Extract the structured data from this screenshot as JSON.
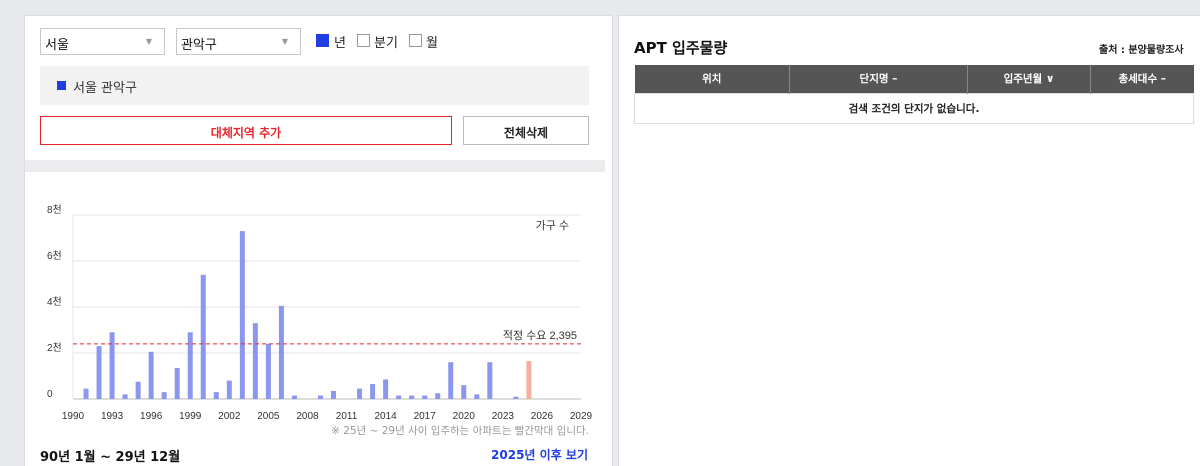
{
  "filters": {
    "city": "서울",
    "district": "관악구",
    "period_options": [
      {
        "label": "년",
        "checked": true
      },
      {
        "label": "분기",
        "checked": false
      },
      {
        "label": "월",
        "checked": false
      }
    ]
  },
  "region_tag": "서울 관악구",
  "buttons": {
    "add_region": "대체지역 추가",
    "delete_all": "전체삭제"
  },
  "chart_data": {
    "type": "bar",
    "legend": "가구 수",
    "x": [
      1990,
      1991,
      1992,
      1993,
      1994,
      1995,
      1996,
      1997,
      1998,
      1999,
      2000,
      2001,
      2002,
      2003,
      2004,
      2005,
      2006,
      2007,
      2008,
      2009,
      2010,
      2011,
      2012,
      2013,
      2014,
      2015,
      2016,
      2017,
      2018,
      2019,
      2020,
      2021,
      2022,
      2023,
      2024,
      2025,
      2026,
      2027,
      2028,
      2029
    ],
    "values": [
      0,
      450,
      2300,
      2900,
      200,
      750,
      2050,
      300,
      1350,
      2900,
      5400,
      300,
      800,
      7300,
      3300,
      2400,
      4050,
      150,
      0,
      150,
      350,
      0,
      450,
      650,
      850,
      150,
      150,
      150,
      250,
      1600,
      600,
      200,
      1600,
      0,
      100,
      1650,
      0,
      0,
      0,
      0
    ],
    "highlight_from": 2025,
    "xticks": [
      1990,
      1993,
      1996,
      1999,
      2002,
      2005,
      2008,
      2011,
      2014,
      2017,
      2020,
      2023,
      2026,
      2029
    ],
    "yticks": [
      0,
      2000,
      4000,
      6000,
      8000
    ],
    "ytick_labels": [
      "0",
      "2천",
      "4천",
      "6천",
      "8천"
    ],
    "ylim": [
      0,
      8000
    ],
    "reference_value": 2395,
    "reference_label": "적정 수요 2,395",
    "colors": {
      "bar": "#8b96ee",
      "highlight": "#f6aca0",
      "reference": "#e8262e"
    }
  },
  "chart_footnote": "※ 25년 ~ 29년 사이 입주하는 아파트는 빨간막대 입니다.",
  "period_text": "90년 1월 ~ 29년 12월",
  "future_link": "2025년 이후 보기",
  "apt": {
    "title": "APT 입주물량",
    "source": "출처 : 분양물량조사",
    "columns": [
      "위치",
      "단지명 –",
      "입주년월 ∨",
      "총세대수 –"
    ],
    "empty_message": "검색 조건의 단지가 없습니다."
  }
}
